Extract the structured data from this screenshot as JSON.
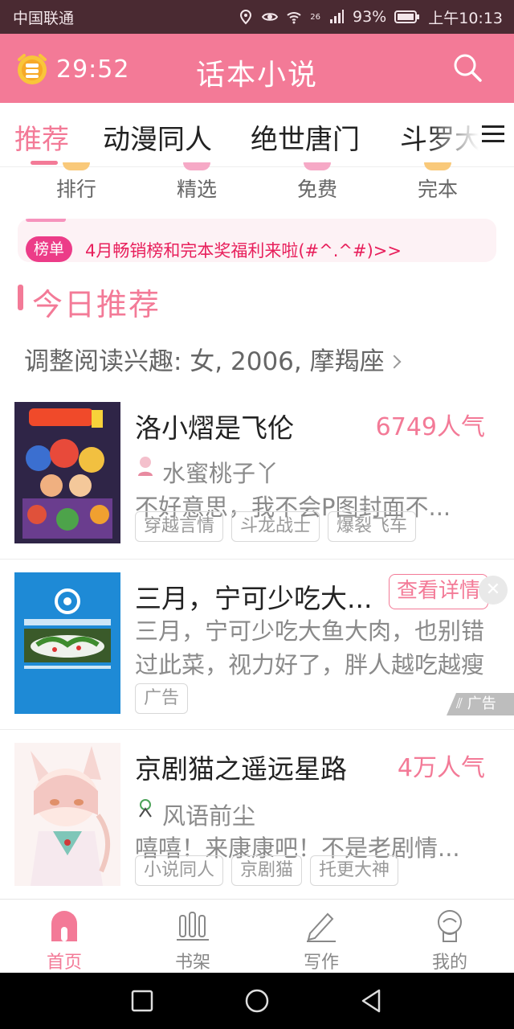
{
  "status_bar": {
    "carrier": "中国联通",
    "network": "26",
    "battery": "93%",
    "time": "上午10:13"
  },
  "header": {
    "timer": "29:52",
    "title": "话本小说",
    "accent_color": "#f37a97"
  },
  "tabs": [
    {
      "label": "推荐",
      "active": true
    },
    {
      "label": "动漫同人"
    },
    {
      "label": "绝世唐门"
    },
    {
      "label": "斗罗大"
    }
  ],
  "quick_links": [
    {
      "label": "排行",
      "color": "#f9c97a"
    },
    {
      "label": "精选",
      "color": "#f6a9c6"
    },
    {
      "label": "免费",
      "color": "#f6a9c6"
    },
    {
      "label": "完本",
      "color": "#f9c97a"
    }
  ],
  "banner": {
    "tag": "榜单",
    "text": "4月畅销榜和完本奖福利来啦(#^.^#)>>"
  },
  "section": {
    "title": "今日推荐",
    "interest": "调整阅读兴趣: 女, 2006, 摩羯座"
  },
  "books": [
    {
      "title": "洛小熠是飞伦",
      "popularity": "6749人气",
      "author": "水蜜桃子丫",
      "desc": "不好意思，我不会P图封面不...",
      "tags": [
        "穿越言情",
        "斗龙战士",
        "爆裂飞车"
      ],
      "cover_icon": "anime-cover-icon"
    },
    {
      "ad": true,
      "title": "三月，宁可少吃大...",
      "button": "查看详情",
      "desc": "三月，宁可少吃大鱼大肉，也别错过此菜，视力好了，胖人越吃越瘦",
      "tags": [
        "广告"
      ],
      "ad_label": "广告",
      "cover_icon": "tencent-news-cover-icon"
    },
    {
      "title": "京剧猫之遥远星路",
      "popularity": "4万人气",
      "author": "风语前尘",
      "desc": "嘻嘻！来康康吧！不是老剧情...",
      "tags": [
        "小说同人",
        "京剧猫",
        "托更大神"
      ],
      "cover_icon": "cat-girl-cover-icon"
    }
  ],
  "bottom_nav": [
    {
      "label": "首页",
      "icon": "home-icon",
      "active": true
    },
    {
      "label": "书架",
      "icon": "bookshelf-icon"
    },
    {
      "label": "写作",
      "icon": "pen-icon"
    },
    {
      "label": "我的",
      "icon": "profile-icon"
    }
  ]
}
